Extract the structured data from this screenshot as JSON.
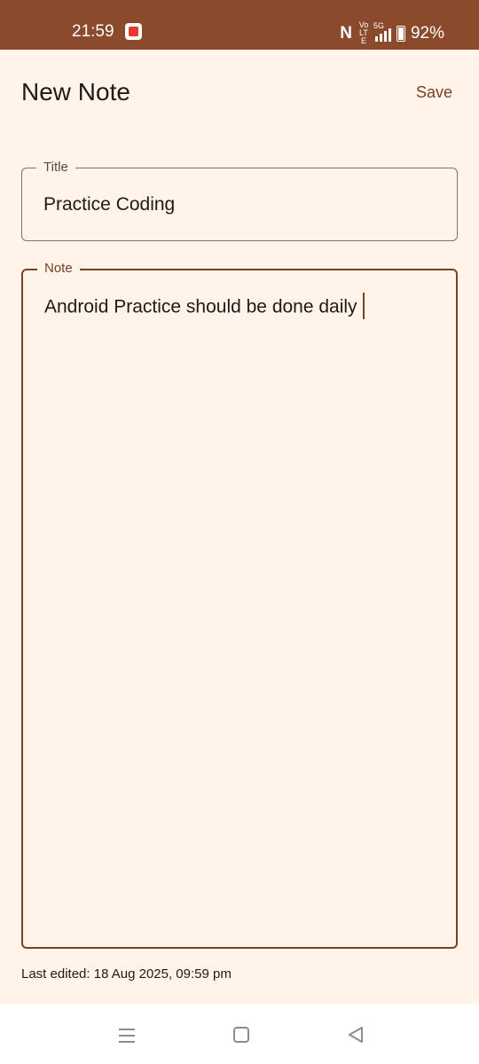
{
  "status_bar": {
    "time": "21:59",
    "network": "5G",
    "volte": "Vo LTE",
    "battery": "92%",
    "icons": [
      "app-notification-icon",
      "nfc-icon",
      "volte-icon",
      "signal-icon",
      "battery-icon"
    ]
  },
  "header": {
    "title": "New Note",
    "save_label": "Save"
  },
  "form": {
    "title_label": "Title",
    "title_value": "Practice Coding",
    "note_label": "Note",
    "note_value": "Android Practice should be done daily"
  },
  "footer": {
    "last_edited": "Last edited: 18 Aug 2025, 09:59 pm"
  },
  "nav_bar": {
    "icons": [
      "recents-icon",
      "home-icon",
      "back-icon"
    ]
  },
  "colors": {
    "status_bar": "#8B4A2B",
    "background": "#FFF3EA",
    "accent": "#7A4224",
    "nav_bar": "#FFFFFF"
  }
}
